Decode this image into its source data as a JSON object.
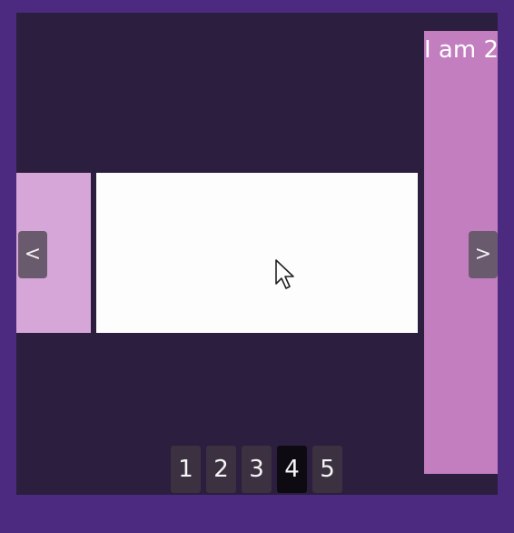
{
  "carousel": {
    "slides": [
      {
        "label": ""
      },
      {
        "label": ""
      },
      {
        "label": "I am 2"
      }
    ],
    "prev_label": "<",
    "next_label": ">",
    "pagination": [
      "1",
      "2",
      "3",
      "4",
      "5"
    ],
    "active_page": "4"
  },
  "colors": {
    "frame": "#4b2a7f",
    "viewport": "#2c1e3f",
    "slide_left": "#d6a6d8",
    "slide_center": "#fdfdfd",
    "slide_right": "#c37ec0",
    "nav_button": "#6a5a6d",
    "page_button": "#3b3140",
    "page_button_active": "#0d0a12"
  },
  "icons": {
    "cursor": "mouse-pointer-icon"
  }
}
